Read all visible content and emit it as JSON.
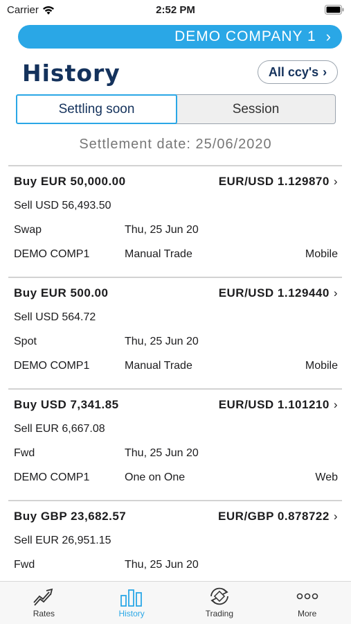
{
  "status_bar": {
    "carrier": "Carrier",
    "time": "2:52 PM"
  },
  "company": {
    "name": "DEMO COMPANY 1"
  },
  "header": {
    "title": "History",
    "ccy_filter": "All ccy's"
  },
  "tabs": [
    {
      "label": "Settling soon",
      "active": true
    },
    {
      "label": "Session",
      "active": false
    }
  ],
  "settlement_date": "Settlement date: 25/06/2020",
  "trades": [
    {
      "buy": "Buy EUR 50,000.00",
      "pair_rate": "EUR/USD 1.129870",
      "sell": "Sell USD 56,493.50",
      "type": "Swap",
      "date": "Thu, 25 Jun 20",
      "company": "DEMO COMP1",
      "method": "Manual Trade",
      "channel": "Mobile"
    },
    {
      "buy": "Buy EUR 500.00",
      "pair_rate": "EUR/USD 1.129440",
      "sell": "Sell USD 564.72",
      "type": "Spot",
      "date": "Thu, 25 Jun 20",
      "company": "DEMO COMP1",
      "method": "Manual Trade",
      "channel": "Mobile"
    },
    {
      "buy": "Buy USD 7,341.85",
      "pair_rate": "EUR/USD 1.101210",
      "sell": "Sell EUR 6,667.08",
      "type": "Fwd",
      "date": "Thu, 25 Jun 20",
      "company": "DEMO COMP1",
      "method": "One on One",
      "channel": "Web"
    },
    {
      "buy": "Buy GBP 23,682.57",
      "pair_rate": "EUR/GBP 0.878722",
      "sell": "Sell EUR 26,951.15",
      "type": "Fwd",
      "date": "Thu, 25 Jun 20",
      "company": "",
      "method": "",
      "channel": ""
    }
  ],
  "tab_bar": [
    {
      "label": "Rates",
      "icon": "trend-up-icon",
      "active": false
    },
    {
      "label": "History",
      "icon": "bar-chart-icon",
      "active": true
    },
    {
      "label": "Trading",
      "icon": "exchange-icon",
      "active": false
    },
    {
      "label": "More",
      "icon": "more-dots-icon",
      "active": false
    }
  ],
  "colors": {
    "accent": "#2aa7e6",
    "title": "#14325c"
  }
}
